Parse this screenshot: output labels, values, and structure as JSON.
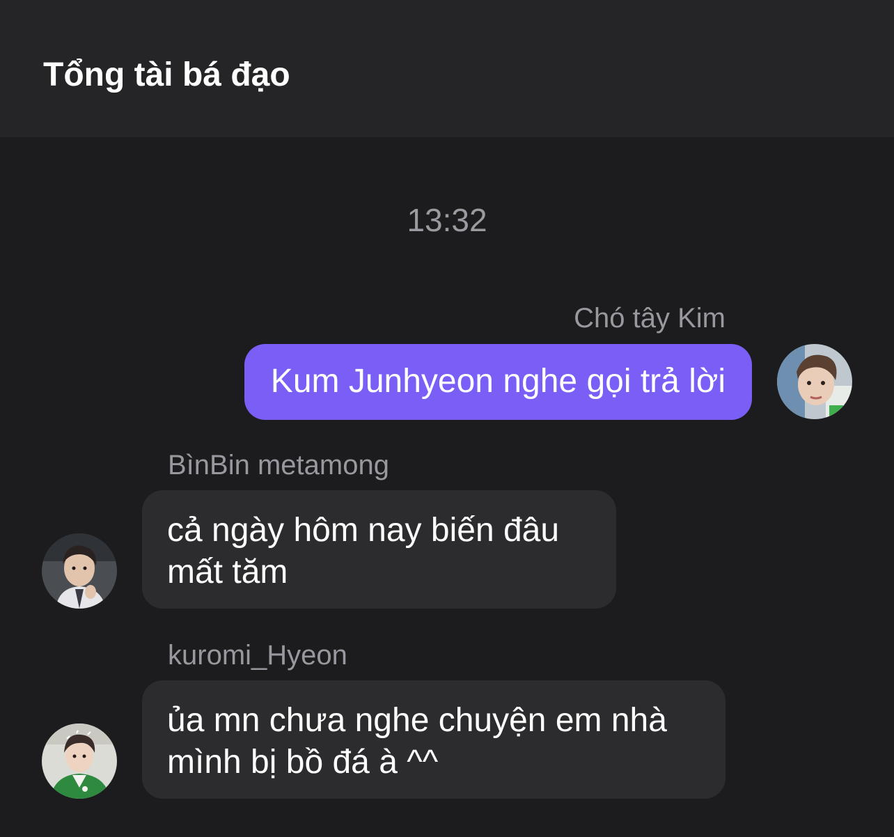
{
  "header": {
    "title": "Tổng tài bá đạo"
  },
  "chat": {
    "timestamp": "13:32",
    "messages": [
      {
        "sender": "Chó tây Kim",
        "text": "Kum Junhyeon nghe gọi trả lời",
        "direction": "outgoing",
        "bubble_color": "#7a5ef6"
      },
      {
        "sender": "BìnBin metamong",
        "text": "cả ngày hôm nay biến đâu mất tăm",
        "direction": "incoming",
        "bubble_color": "#2c2c2f"
      },
      {
        "sender": "kuromi_Hyeon",
        "text": "ủa mn chưa nghe chuyện em nhà mình bị bồ đá à ^^",
        "direction": "incoming",
        "bubble_color": "#2c2c2f"
      }
    ]
  },
  "colors": {
    "background": "#1c1c1e",
    "header_background": "#252527",
    "accent": "#7a5ef6"
  }
}
